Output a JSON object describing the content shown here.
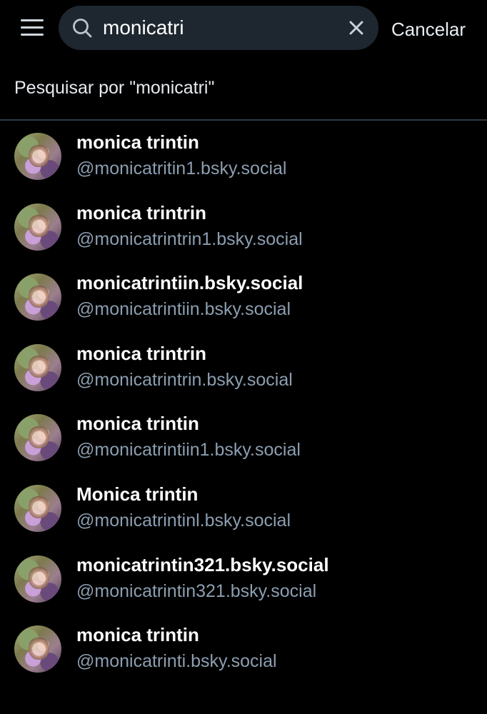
{
  "header": {
    "search_value": "monicatri",
    "cancel_label": "Cancelar",
    "icons": {
      "menu": "menu-icon",
      "search": "search-icon",
      "clear": "close-icon"
    }
  },
  "search_for": "Pesquisar por \"monicatri\"",
  "colors": {
    "background": "#000000",
    "search_box": "#1e2730",
    "handle_text": "#8c9eb0",
    "divider": "#2e3a44"
  },
  "results": [
    {
      "name": "monica trintin",
      "handle": "@monicatritin1.bsky.social"
    },
    {
      "name": "monica trintrin",
      "handle": "@monicatrintrin1.bsky.social"
    },
    {
      "name": "monicatrintiin.bsky.social",
      "handle": "@monicatrintiin.bsky.social"
    },
    {
      "name": "monica trintrin",
      "handle": "@monicatrintrin.bsky.social"
    },
    {
      "name": "monica trintin",
      "handle": "@monicatrintiin1.bsky.social"
    },
    {
      "name": "Monica trintin",
      "handle": "@monicatrintinl.bsky.social"
    },
    {
      "name": "monicatrintin321.bsky.social",
      "handle": "@monicatrintin321.bsky.social"
    },
    {
      "name": "monica trintin",
      "handle": "@monicatrinti.bsky.social"
    }
  ]
}
